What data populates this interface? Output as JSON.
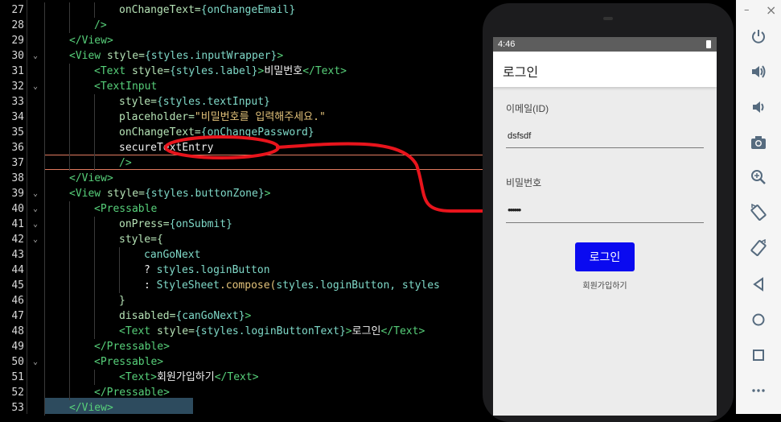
{
  "editor": {
    "lines": [
      {
        "n": "27",
        "indent": 3,
        "parts": [
          {
            "t": "onChangeText=",
            "c": "attr"
          },
          {
            "t": "{onChangeEmail}",
            "c": "attrv"
          }
        ]
      },
      {
        "n": "28",
        "indent": 2,
        "parts": [
          {
            "t": "/>",
            "c": "kw"
          }
        ]
      },
      {
        "n": "29",
        "indent": 1,
        "parts": [
          {
            "t": "</View>",
            "c": "kw"
          }
        ]
      },
      {
        "n": "30",
        "indent": 1,
        "fold": true,
        "parts": [
          {
            "t": "<View ",
            "c": "kw"
          },
          {
            "t": "style=",
            "c": "attr"
          },
          {
            "t": "{styles.inputWrapper}",
            "c": "attrv"
          },
          {
            "t": ">",
            "c": "kw"
          }
        ]
      },
      {
        "n": "31",
        "indent": 2,
        "parts": [
          {
            "t": "<Text ",
            "c": "kw"
          },
          {
            "t": "style=",
            "c": "attr"
          },
          {
            "t": "{styles.label}",
            "c": "attrv"
          },
          {
            "t": ">",
            "c": "kw"
          },
          {
            "t": "비밀번호",
            "c": "ko"
          },
          {
            "t": "</Text>",
            "c": "kw"
          }
        ]
      },
      {
        "n": "32",
        "indent": 2,
        "fold": true,
        "parts": [
          {
            "t": "<TextInput",
            "c": "kw"
          }
        ]
      },
      {
        "n": "33",
        "indent": 3,
        "parts": [
          {
            "t": "style=",
            "c": "attr"
          },
          {
            "t": "{styles.textInput}",
            "c": "attrv"
          }
        ]
      },
      {
        "n": "34",
        "indent": 3,
        "parts": [
          {
            "t": "placeholder=",
            "c": "attr"
          },
          {
            "t": "\"비밀번호를 입력해주세요.\"",
            "c": "str"
          }
        ]
      },
      {
        "n": "35",
        "indent": 3,
        "parts": [
          {
            "t": "onChangeText=",
            "c": "attr"
          },
          {
            "t": "{onChangePassword}",
            "c": "attrv"
          }
        ]
      },
      {
        "n": "36",
        "indent": 3,
        "parts": [
          {
            "t": "secureTextEntry",
            "c": "white"
          }
        ]
      },
      {
        "n": "37",
        "indent": 3,
        "parts": [
          {
            "t": "/>",
            "c": "kw"
          }
        ]
      },
      {
        "n": "38",
        "indent": 1,
        "parts": [
          {
            "t": "</View>",
            "c": "kw"
          }
        ]
      },
      {
        "n": "39",
        "indent": 1,
        "fold": true,
        "parts": [
          {
            "t": "<View ",
            "c": "kw"
          },
          {
            "t": "style=",
            "c": "attr"
          },
          {
            "t": "{styles.buttonZone}",
            "c": "attrv"
          },
          {
            "t": ">",
            "c": "kw"
          }
        ]
      },
      {
        "n": "40",
        "indent": 2,
        "fold": true,
        "parts": [
          {
            "t": "<Pressable",
            "c": "kw"
          }
        ]
      },
      {
        "n": "41",
        "indent": 3,
        "fold": true,
        "parts": [
          {
            "t": "onPress=",
            "c": "attr"
          },
          {
            "t": "{onSubmit}",
            "c": "attrv"
          }
        ]
      },
      {
        "n": "42",
        "indent": 3,
        "fold": true,
        "parts": [
          {
            "t": "style={",
            "c": "attr"
          }
        ]
      },
      {
        "n": "43",
        "indent": 4,
        "parts": [
          {
            "t": "canGoNext",
            "c": "attrv"
          }
        ]
      },
      {
        "n": "44",
        "indent": 4,
        "parts": [
          {
            "t": "? ",
            "c": "white"
          },
          {
            "t": "styles.loginButton",
            "c": "attrv"
          }
        ]
      },
      {
        "n": "45",
        "indent": 4,
        "parts": [
          {
            "t": ": ",
            "c": "white"
          },
          {
            "t": "StyleSheet",
            "c": "attrv"
          },
          {
            "t": ".compose(",
            "c": "str"
          },
          {
            "t": "styles.loginButton, styles",
            "c": "attrv"
          }
        ]
      },
      {
        "n": "46",
        "indent": 3,
        "parts": [
          {
            "t": "}",
            "c": "attr"
          }
        ]
      },
      {
        "n": "47",
        "indent": 3,
        "parts": [
          {
            "t": "disabled=",
            "c": "attr"
          },
          {
            "t": "{canGoNext}",
            "c": "attrv"
          },
          {
            "t": ">",
            "c": "kw"
          }
        ]
      },
      {
        "n": "48",
        "indent": 3,
        "parts": [
          {
            "t": "<Text ",
            "c": "kw"
          },
          {
            "t": "style=",
            "c": "attr"
          },
          {
            "t": "{styles.loginButtonText}",
            "c": "attrv"
          },
          {
            "t": ">",
            "c": "kw"
          },
          {
            "t": "로그인",
            "c": "ko"
          },
          {
            "t": "</Text>",
            "c": "kw"
          }
        ]
      },
      {
        "n": "49",
        "indent": 2,
        "parts": [
          {
            "t": "</Pressable>",
            "c": "kw"
          }
        ]
      },
      {
        "n": "50",
        "indent": 2,
        "fold": true,
        "parts": [
          {
            "t": "<Pressable>",
            "c": "kw"
          }
        ]
      },
      {
        "n": "51",
        "indent": 3,
        "parts": [
          {
            "t": "<Text>",
            "c": "kw"
          },
          {
            "t": "회원가입하기",
            "c": "ko"
          },
          {
            "t": "</Text>",
            "c": "kw"
          }
        ]
      },
      {
        "n": "52",
        "indent": 2,
        "parts": [
          {
            "t": "</Pressable>",
            "c": "kw"
          }
        ]
      },
      {
        "n": "53",
        "indent": 1,
        "parts": [
          {
            "t": "</View>",
            "c": "kw"
          }
        ]
      }
    ],
    "annotation_color": "#e8141c"
  },
  "phone": {
    "status_time": "4:46",
    "app_title": "로그인",
    "email_label": "이메일(ID)",
    "email_value": "dsfsdf",
    "password_label": "비밀번호",
    "password_value": "••••••",
    "login_button": "로그인",
    "signup_link": "회원가입하기",
    "login_button_color": "#0a0af0"
  },
  "sidebar": {
    "buttons": [
      "power-icon",
      "volume-up-icon",
      "volume-down-icon",
      "camera-icon",
      "zoom-in-icon",
      "rotate-left-icon",
      "rotate-right-icon",
      "back-icon",
      "home-icon",
      "overview-icon",
      "more-icon"
    ],
    "close_glyph": "×",
    "minimize_glyph": "–"
  }
}
